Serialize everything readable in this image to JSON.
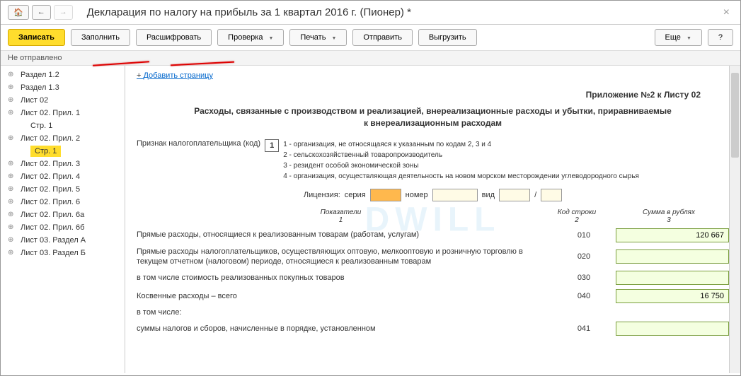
{
  "title": "Декларация по налогу на прибыль за 1 квартал 2016 г. (Пионер) *",
  "toolbar": {
    "save": "Записать",
    "fill": "Заполнить",
    "decode": "Расшифровать",
    "check": "Проверка",
    "print": "Печать",
    "send": "Отправить",
    "export": "Выгрузить",
    "more": "Еще",
    "help": "?"
  },
  "status": "Не отправлено",
  "tree": [
    {
      "label": "Раздел 1.2"
    },
    {
      "label": "Раздел 1.3"
    },
    {
      "label": "Лист 02"
    },
    {
      "label": "Лист 02. Прил. 1"
    },
    {
      "label": "Стр. 1",
      "leaf": true
    },
    {
      "label": "Лист 02. Прил. 2"
    },
    {
      "label": "Стр. 1",
      "leaf": true,
      "selected": true
    },
    {
      "label": "Лист 02. Прил. 3"
    },
    {
      "label": "Лист 02. Прил. 4"
    },
    {
      "label": "Лист 02. Прил. 5"
    },
    {
      "label": "Лист 02. Прил. 6"
    },
    {
      "label": "Лист 02. Прил. 6а"
    },
    {
      "label": "Лист 02. Прил. 6б"
    },
    {
      "label": "Лист 03. Раздел А"
    },
    {
      "label": "Лист 03. Раздел Б"
    }
  ],
  "main": {
    "add_page": "Добавить страницу",
    "appendix": "Приложение №2 к Листу 02",
    "doc_title": "Расходы, связанные с производством и реализацией, внереализационные расходы и убытки, приравниваемые к внереализационным расходам",
    "taxpayer_label": "Признак налогоплательщика (код)",
    "taxpayer_code": "1",
    "taxpayer_desc": [
      "1 - организация, не относящаяся к указанным по кодам 2, 3 и 4",
      "2 - сельскохозяйственный товаропроизводитель",
      "3 - резидент особой экономической зоны",
      "4 - организация, осуществляющая деятельность на новом морском месторождении углеводородного сырья"
    ],
    "license": {
      "label": "Лицензия:",
      "series": "серия",
      "number": "номер",
      "type": "вид",
      "sep": "/"
    },
    "cols": {
      "c1": "Показатели",
      "c1n": "1",
      "c2": "Код строки",
      "c2n": "2",
      "c3": "Сумма в рублях",
      "c3n": "3"
    },
    "rows": [
      {
        "label": "Прямые расходы, относящиеся к реализованным товарам (работам, услугам)",
        "code": "010",
        "value": "120 667"
      },
      {
        "label": "Прямые расходы налогоплательщиков, осуществляющих оптовую, мелкооптовую и розничную торговлю в текущем отчетном (налоговом) периоде, относящиеся к реализованным товарам",
        "code": "020",
        "value": ""
      },
      {
        "label": "в том числе стоимость реализованных покупных товаров",
        "code": "030",
        "value": ""
      },
      {
        "label": "Косвенные расходы – всего",
        "code": "040",
        "value": "16 750"
      },
      {
        "label": "в том числе:",
        "code": "",
        "value": null
      },
      {
        "label": "суммы налогов и сборов, начисленные в порядке, установленном",
        "code": "041",
        "value": ""
      }
    ]
  }
}
